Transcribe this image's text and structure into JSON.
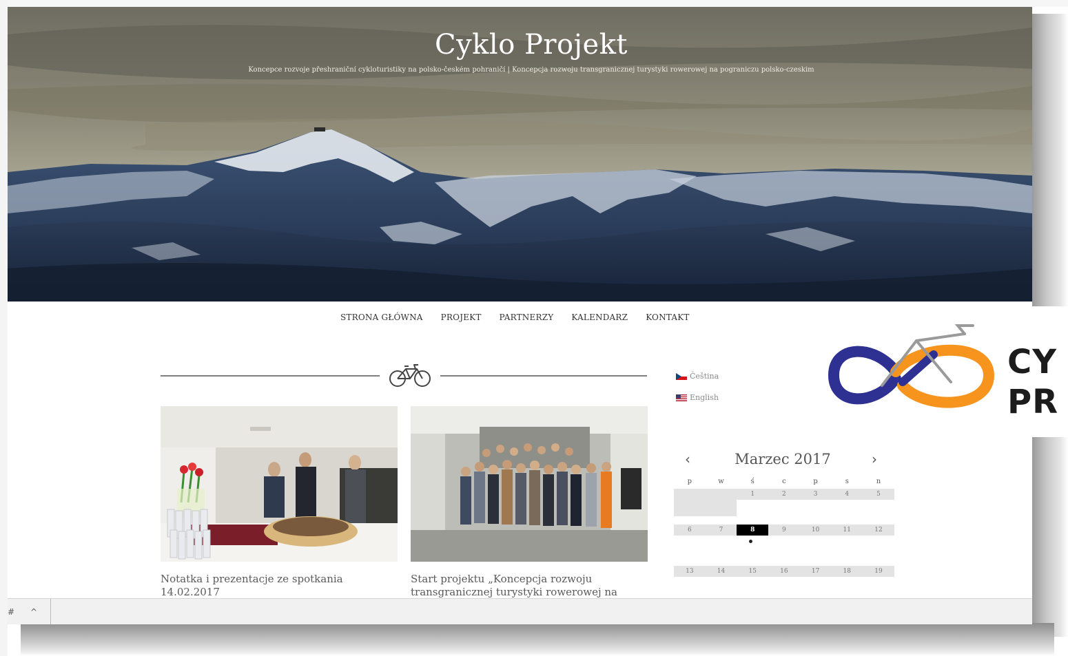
{
  "site": {
    "title": "Cyklo Projekt",
    "subtitle": "Koncepce rozvoje přeshraniční cykloturistiky na polsko-českém pohraničí | Koncepcja rozwoju transgranicznej turystyki rowerowej na pograniczu polsko-czeskim"
  },
  "nav": {
    "items": [
      "STRONA GŁÓWNA",
      "PROJEKT",
      "PARTNERZY",
      "KALENDARZ",
      "KONTAKT"
    ]
  },
  "divider": {
    "icon": "bicycle-icon"
  },
  "posts": [
    {
      "title": "Notatka i prezentacje ze spotkania 14.02.2017"
    },
    {
      "title": "Start projektu „Koncepcja rozwoju transgranicznej turystyki rowerowej na"
    }
  ],
  "languages": [
    {
      "label": "Čeština",
      "flag": "cz-flag-icon"
    },
    {
      "label": "English",
      "flag": "us-flag-icon"
    }
  ],
  "calendar": {
    "month": "Marzec 2017",
    "prev": "‹",
    "next": "›",
    "weekdays": [
      "p",
      "w",
      "ś",
      "c",
      "p",
      "s",
      "n"
    ],
    "weeks": [
      [
        "",
        "",
        "1",
        "2",
        "3",
        "4",
        "5"
      ],
      [
        "6",
        "7",
        "8",
        "9",
        "10",
        "11",
        "12"
      ],
      [
        "13",
        "14",
        "15",
        "16",
        "17",
        "18",
        "19"
      ]
    ],
    "today": "8"
  },
  "statusbar": {
    "hash": "#",
    "caret": "^"
  },
  "logo": {
    "line1": "CY",
    "line2": "PR"
  },
  "colors": {
    "logo_blue": "#2e3192",
    "logo_orange": "#f7941d",
    "hero_sky": "#8a8677",
    "hero_mountain": "#2a3d5c"
  }
}
